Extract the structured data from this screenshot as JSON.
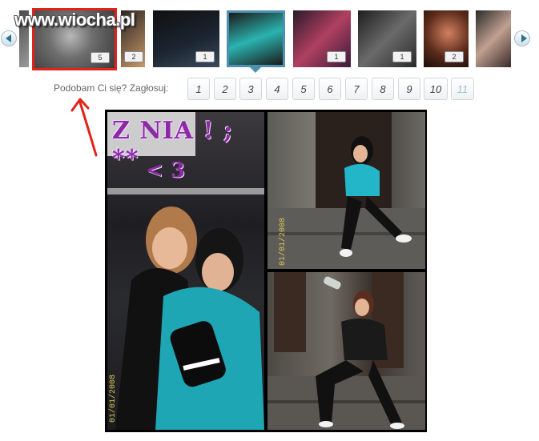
{
  "site": {
    "watermark": "www.wiocha.pl"
  },
  "thumbnails": [
    {
      "name": "thumb-1",
      "badge": "",
      "state": "normal",
      "colors": [
        "#4a4a4a",
        "#9a9a9a"
      ]
    },
    {
      "name": "thumb-2",
      "badge": "5",
      "state": "selected",
      "colors": [
        "#3a3a3a",
        "#8d8d8d"
      ]
    },
    {
      "name": "thumb-3",
      "badge": "2",
      "state": "normal",
      "colors": [
        "#2a2320",
        "#c89a6a"
      ]
    },
    {
      "name": "thumb-4",
      "badge": "1",
      "state": "normal",
      "colors": [
        "#101010",
        "#2a3a4a"
      ]
    },
    {
      "name": "thumb-5",
      "badge": "",
      "state": "current",
      "colors": [
        "#1a1a1a",
        "#2bb3b0"
      ]
    },
    {
      "name": "thumb-6",
      "badge": "1",
      "state": "normal",
      "colors": [
        "#2a1a2a",
        "#b04060"
      ]
    },
    {
      "name": "thumb-7",
      "badge": "1",
      "state": "normal",
      "colors": [
        "#1e1e1e",
        "#6a6a6a"
      ]
    },
    {
      "name": "thumb-8",
      "badge": "2",
      "state": "normal",
      "colors": [
        "#1a0f0a",
        "#d08060"
      ]
    },
    {
      "name": "thumb-9",
      "badge": "",
      "state": "normal",
      "colors": [
        "#2a2a2a",
        "#c0a090"
      ]
    }
  ],
  "vote": {
    "label": "Podobam Ci się? Zagłosuj:",
    "buttons": [
      "1",
      "2",
      "3",
      "4",
      "5",
      "6",
      "7",
      "8",
      "9",
      "10",
      "11"
    ]
  },
  "photo": {
    "caption_line1": "Z NIA ! ; **",
    "caption_line2": "< 3",
    "date_stamp": "01/01/2008"
  },
  "colors": {
    "selected_border": "#e2231a",
    "current_border": "#4f8fb0",
    "caption": "#8a2ba3",
    "annotation_arrow": "#e2231a"
  }
}
